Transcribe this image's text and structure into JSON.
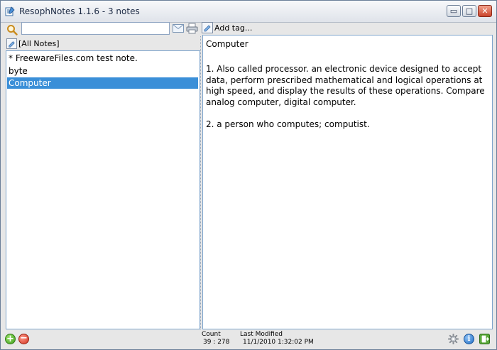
{
  "window": {
    "title": "ResophNotes 1.1.6 - 3 notes",
    "min_glyph": "▭",
    "max_glyph": "□",
    "close_glyph": "✕"
  },
  "toolbar": {
    "search_placeholder": "",
    "search_value": ""
  },
  "tagbar": {
    "add_tag_label": "Add tag..."
  },
  "notes_panel": {
    "tag_filter_label": "[All Notes]",
    "items": [
      {
        "label": "* FreewareFiles.com test note."
      },
      {
        "label": "byte"
      },
      {
        "label": "Computer"
      }
    ],
    "selected_index": 2
  },
  "editor": {
    "lines": [
      "Computer",
      "",
      "1. Also called processor. an electronic device designed to accept data, perform prescribed mathematical and logical operations at high speed, and display the results of these operations. Compare analog computer, digital computer.",
      "",
      "2. a person who computes; computist."
    ]
  },
  "statusbar": {
    "count_label": "Count",
    "count_value": "39 : 278",
    "modified_label": "Last Modified",
    "modified_value": "11/1/2010 1:32:02 PM",
    "add_glyph": "+",
    "delete_glyph": "−",
    "info_glyph": "i"
  },
  "colors": {
    "selection": "#3a8fd8",
    "panel_border": "#7ea4cc",
    "chrome": "#e7e7e7"
  }
}
